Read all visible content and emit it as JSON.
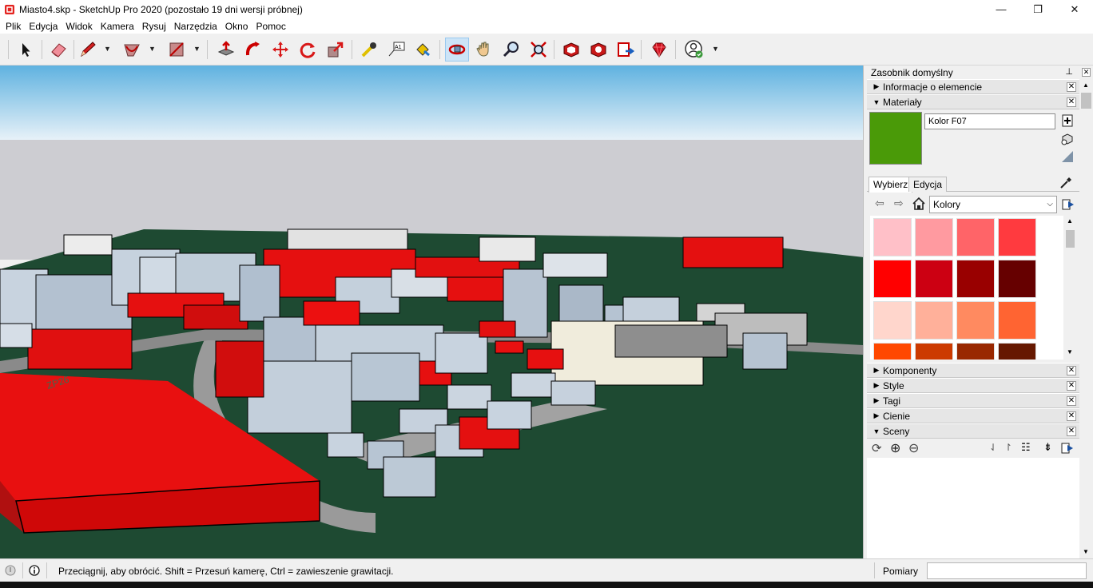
{
  "window": {
    "title": "Miasto4.skp - SketchUp Pro 2020 (pozostało 19 dni wersji próbnej)",
    "minimize": "—",
    "restore": "❐",
    "close": "✕"
  },
  "menu": [
    "Plik",
    "Edycja",
    "Widok",
    "Kamera",
    "Rysuj",
    "Narzędzia",
    "Okno",
    "Pomoc"
  ],
  "toolbar": {
    "tools": [
      "select-tool",
      "eraser-tool",
      "line-tool",
      "arc-tool",
      "rectangle-tool",
      "push-pull-tool",
      "follow-me-tool",
      "move-tool",
      "rotate-tool",
      "scale-tool",
      "tape-measure-tool",
      "text-tool",
      "paint-bucket-tool",
      "orbit-tool",
      "pan-tool",
      "zoom-tool",
      "zoom-extents-tool",
      "3d-warehouse",
      "extension-warehouse",
      "layout",
      "ruby-extension",
      "profile"
    ],
    "active_tool": "orbit-tool",
    "text_tool_glyph": "A1"
  },
  "tray": {
    "title": "Zasobnik domyślny",
    "pin": "⊥",
    "panels_top": [
      {
        "label": "Informacje o elemencie",
        "expanded": false
      },
      {
        "label": "Materiały",
        "expanded": true
      }
    ],
    "materials": {
      "name": "Kolor F07",
      "swatch_color": "#4a9a08",
      "tabs": [
        "Wybierz",
        "Edycja"
      ],
      "selected_tab": "Wybierz",
      "library": "Kolory",
      "colors": [
        "#ffc0c8",
        "#ff9aa0",
        "#ff6468",
        "#ff3a3f",
        "#ff0000",
        "#cc0012",
        "#990000",
        "#660000",
        "#ffd6cc",
        "#ffb09a",
        "#ff8a60",
        "#ff6432",
        "#ff4800",
        "#cc3a00",
        "#992800",
        "#661800"
      ]
    },
    "panels_bottom": [
      {
        "label": "Komponenty",
        "expanded": false
      },
      {
        "label": "Style",
        "expanded": false
      },
      {
        "label": "Tagi",
        "expanded": false
      },
      {
        "label": "Cienie",
        "expanded": false
      },
      {
        "label": "Sceny",
        "expanded": true
      }
    ]
  },
  "status": {
    "hint": "Przeciągnij, aby obrócić. Shift = Przesuń kamerę, Ctrl = zawieszenie grawitacji.",
    "measure_label": "Pomiary",
    "measure_value": ""
  }
}
